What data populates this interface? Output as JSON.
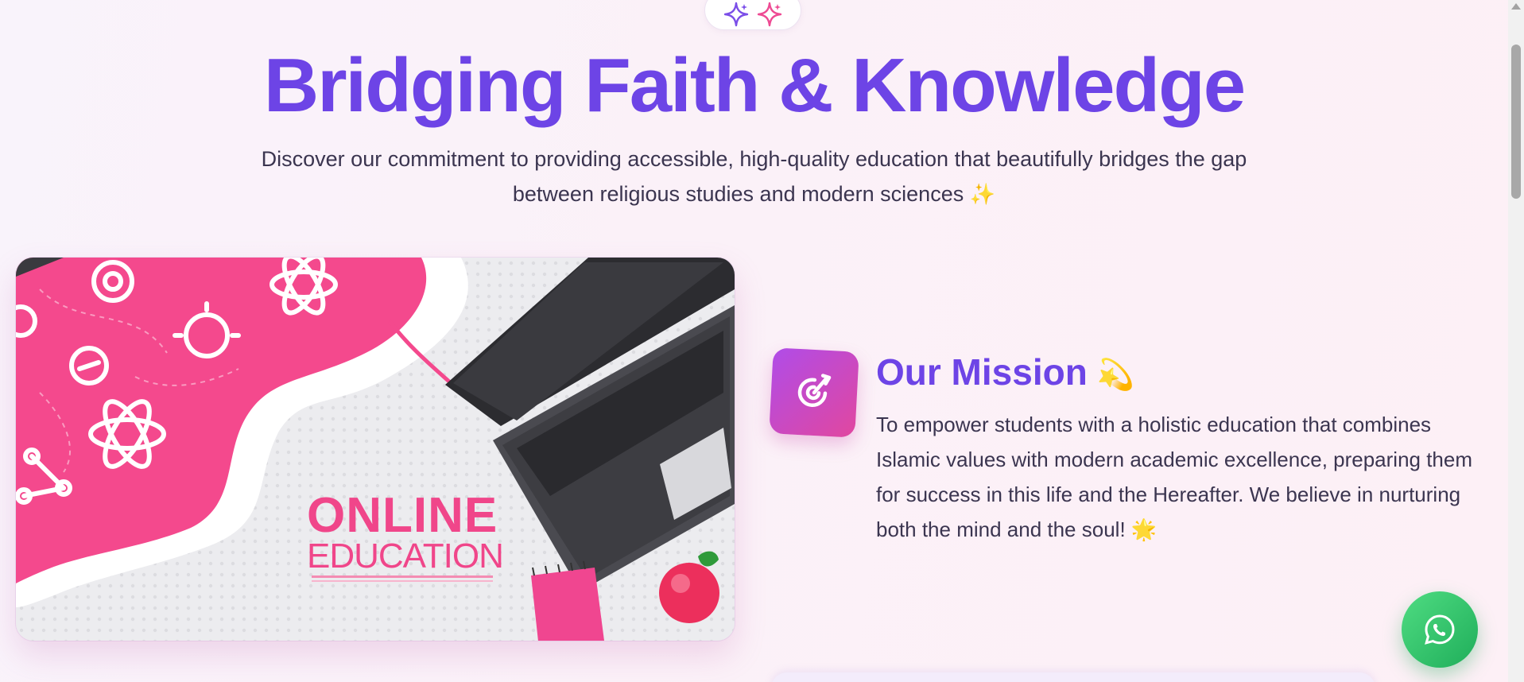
{
  "hero": {
    "title": "Bridging Faith & Knowledge",
    "subtitle_line1": "Discover our commitment to providing accessible, high-quality education that beautifully bridges the gap",
    "subtitle_line2": "between religious studies and modern sciences",
    "subtitle_emoji": "✨"
  },
  "image": {
    "headline": "ONLINE",
    "subheadline": "EDUCATION"
  },
  "mission": {
    "title": "Our Mission",
    "title_emoji": "💫",
    "text": "To empower students with a holistic education that combines Islamic values with modern academic excellence, preparing them for success in this life and the Hereafter. We believe in nurturing both the mind and the soul!",
    "text_emoji": "🌟"
  },
  "icons": {
    "sparkle_left": "sparkle-icon",
    "sparkle_right": "sparkle-icon",
    "mission": "target-icon",
    "whatsapp": "whatsapp-icon"
  },
  "colors": {
    "accent_purple": "#6d44e6",
    "accent_pink": "#f0468a",
    "whatsapp_green": "#25c165",
    "text_dark": "#3b3550"
  }
}
